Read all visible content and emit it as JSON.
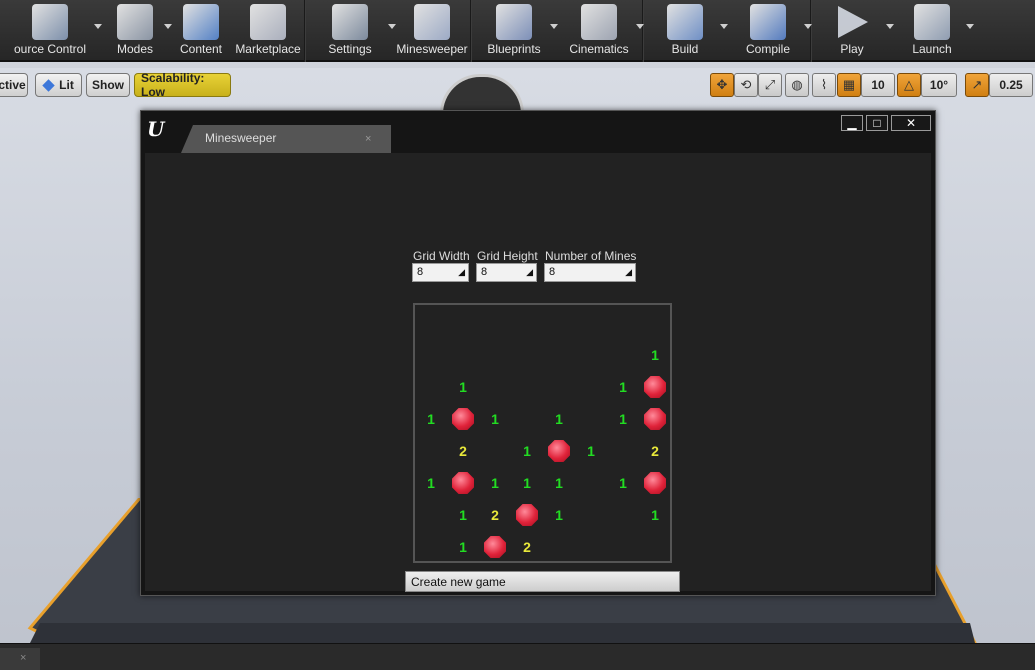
{
  "toolbar": {
    "items": [
      {
        "label": "ource Control",
        "icon": "source-control-icon",
        "dropdown": true
      },
      {
        "label": "Modes",
        "icon": "modes-icon",
        "dropdown": true
      },
      {
        "label": "Content",
        "icon": "content-icon",
        "dropdown": false
      },
      {
        "label": "Marketplace",
        "icon": "marketplace-icon",
        "dropdown": false
      },
      {
        "label": "Settings",
        "icon": "settings-icon",
        "dropdown": true
      },
      {
        "label": "Minesweeper",
        "icon": "minesweeper-icon",
        "dropdown": false
      },
      {
        "label": "Blueprints",
        "icon": "blueprints-icon",
        "dropdown": true
      },
      {
        "label": "Cinematics",
        "icon": "cinematics-icon",
        "dropdown": true
      },
      {
        "label": "Build",
        "icon": "build-icon",
        "dropdown": true
      },
      {
        "label": "Compile",
        "icon": "compile-icon",
        "dropdown": true
      },
      {
        "label": "Play",
        "icon": "play-icon",
        "dropdown": true
      },
      {
        "label": "Launch",
        "icon": "launch-icon",
        "dropdown": true
      }
    ]
  },
  "viewport": {
    "perspective_label": "ctive",
    "lit_label": "Lit",
    "show_label": "Show",
    "scalability_label": "Scalability: Low",
    "grid_snap_value": "10",
    "rotation_snap_value": "10°",
    "scale_snap_value": "0.25",
    "accent_color": "#e8a02c"
  },
  "window": {
    "tab_title": "Minesweeper",
    "close_glyph": "×",
    "controls": {
      "minimize": "▁",
      "maximize": "□",
      "close": "✕"
    }
  },
  "settings": {
    "grid_width_label": "Grid Width",
    "grid_width_value": "8",
    "grid_height_label": "Grid Height",
    "grid_height_value": "8",
    "mines_label": "Number of Mines",
    "mines_value": "8"
  },
  "board": {
    "rows": 8,
    "cols": 8,
    "number_colors": {
      "1": "#22dd22",
      "2": "#e8e83a"
    },
    "mine_color": "#e0233a",
    "cells": [
      [
        "",
        "",
        "",
        "",
        "",
        "",
        "",
        ""
      ],
      [
        "",
        "",
        "",
        "",
        "",
        "",
        "",
        "1"
      ],
      [
        "",
        "1",
        "",
        "",
        "",
        "",
        "1",
        "M"
      ],
      [
        "1",
        "M",
        "1",
        "",
        "1",
        "",
        "1",
        "M"
      ],
      [
        "",
        "2",
        "",
        "1",
        "M",
        "1",
        "",
        "2"
      ],
      [
        "1",
        "M",
        "1",
        "1",
        "1",
        "",
        "1",
        "M"
      ],
      [
        "",
        "1",
        "2",
        "M",
        "1",
        "",
        "",
        "1"
      ],
      [
        "",
        "1",
        "M",
        "2",
        "",
        "",
        "",
        ""
      ]
    ]
  },
  "new_game_label": "Create new game",
  "bottom": {
    "tab_close": "×"
  }
}
